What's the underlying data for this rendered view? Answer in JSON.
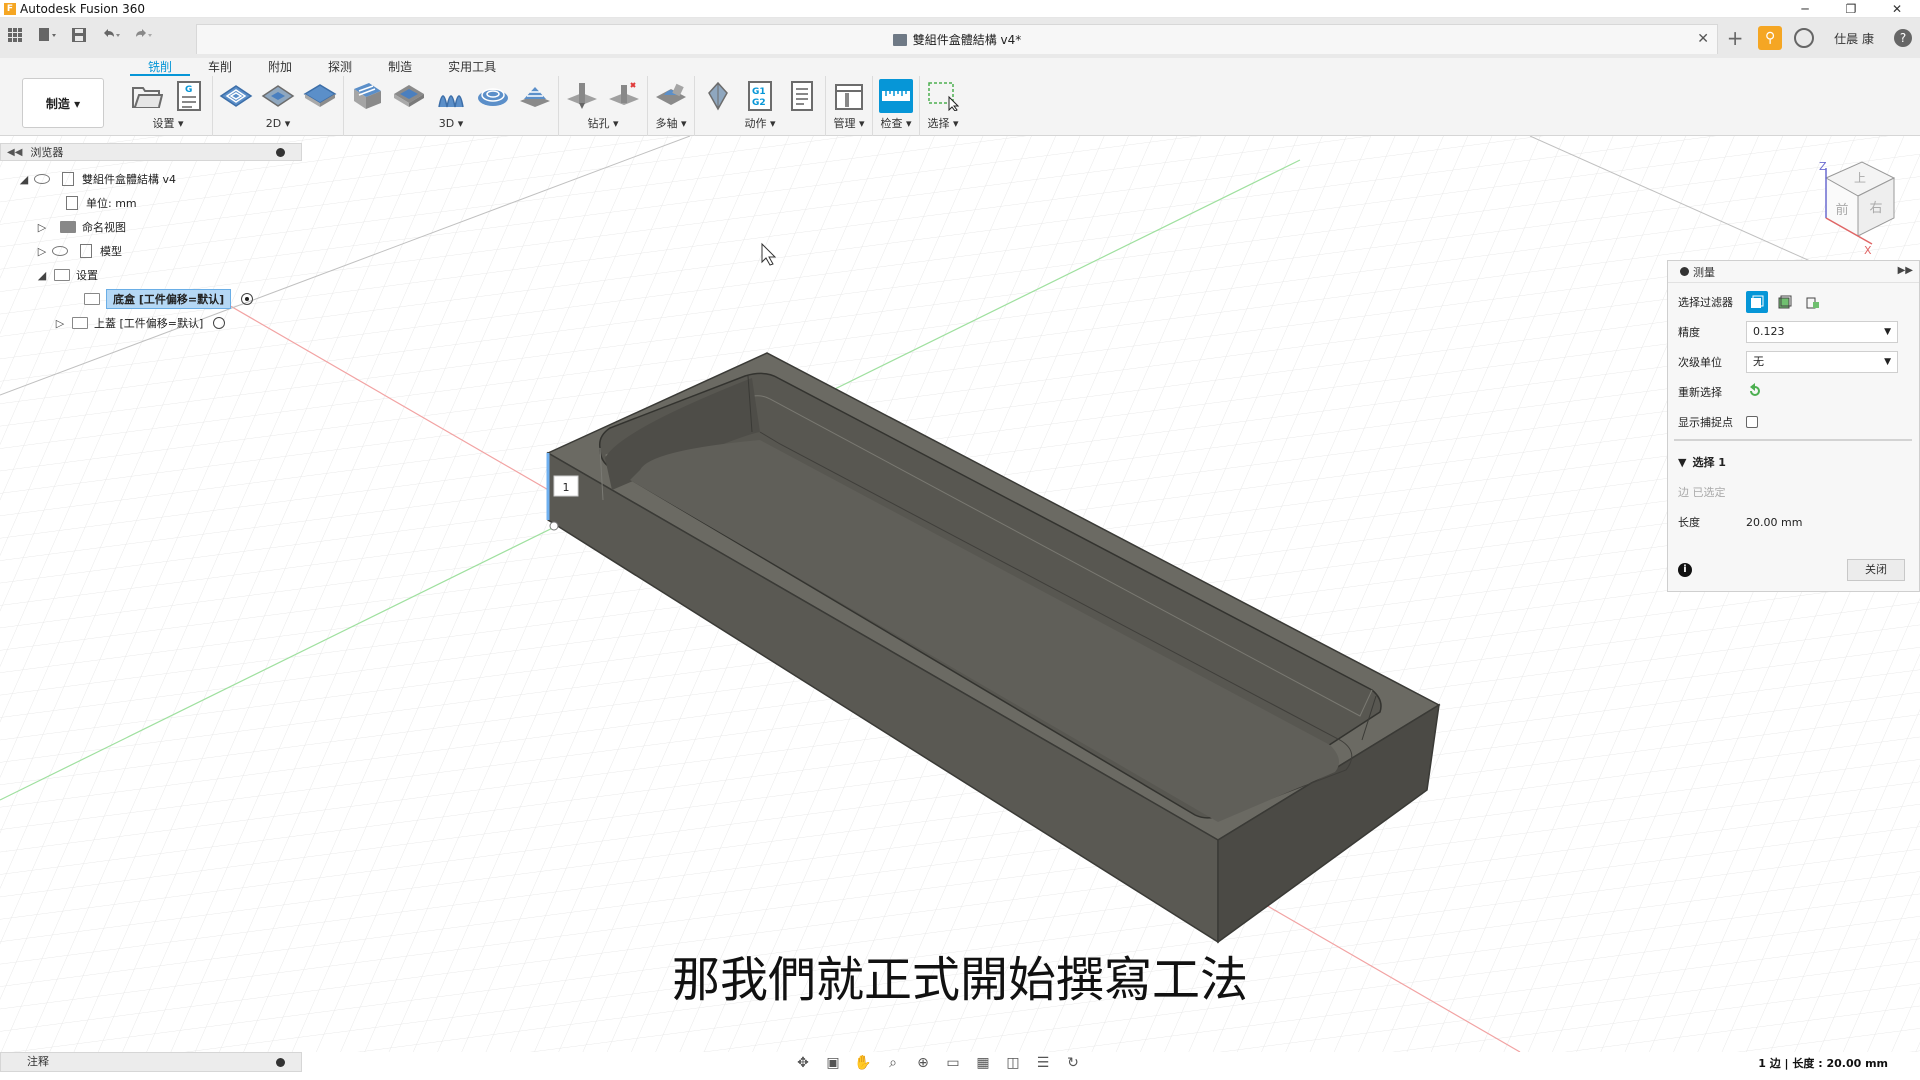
{
  "window": {
    "app_title": "Autodesk Fusion 360",
    "logo_letter": "F",
    "min": "─",
    "max": "❐",
    "close": "✕"
  },
  "document": {
    "title": "雙組件盒體結構 v4*"
  },
  "account": {
    "user": "仕晨 康"
  },
  "ribbon": {
    "tabs": [
      "铣削",
      "车削",
      "附加",
      "探测",
      "制造",
      "实用工具"
    ],
    "active_tab": 0,
    "workspace": "制造 ▾",
    "groups": [
      "设置 ▾",
      "2D ▾",
      "3D ▾",
      "钻孔 ▾",
      "多轴 ▾",
      "动作 ▾",
      "管理 ▾",
      "检查 ▾",
      "选择 ▾"
    ]
  },
  "browser": {
    "title": "浏览器",
    "root": "雙組件盒體結構 v4",
    "units": "单位: mm",
    "named_views": "命名视图",
    "models": "模型",
    "setups": "设置",
    "setup_1": "底盒 [工件偏移=默认]",
    "setup_2": "上蓋 [工件偏移=默认]"
  },
  "measure": {
    "title": "测量",
    "filter_label": "选择过滤器",
    "precision_label": "精度",
    "precision_value": "0.123",
    "secondary_unit_label": "次级单位",
    "secondary_unit_value": "无",
    "reselect_label": "重新选择",
    "show_snap_label": "显示捕捉点",
    "selection_header": "选择 1",
    "selected_text": "边 已选定",
    "length_label": "长度",
    "length_value": "20.00 mm",
    "close_button": "关闭"
  },
  "viewport": {
    "point_label": "1",
    "viewcube_top": "上",
    "viewcube_front": "前",
    "viewcube_right": "右",
    "axis_z": "Z",
    "axis_x": "X"
  },
  "notes": {
    "label": "注释"
  },
  "status": {
    "text": "1 边 | 长度 : 20.00 mm"
  },
  "subtitle": {
    "text": "那我們就正式開始撰寫工法"
  },
  "colors": {
    "accent": "#0696d7",
    "brand": "#f5a623",
    "model": "#6b6a63"
  }
}
